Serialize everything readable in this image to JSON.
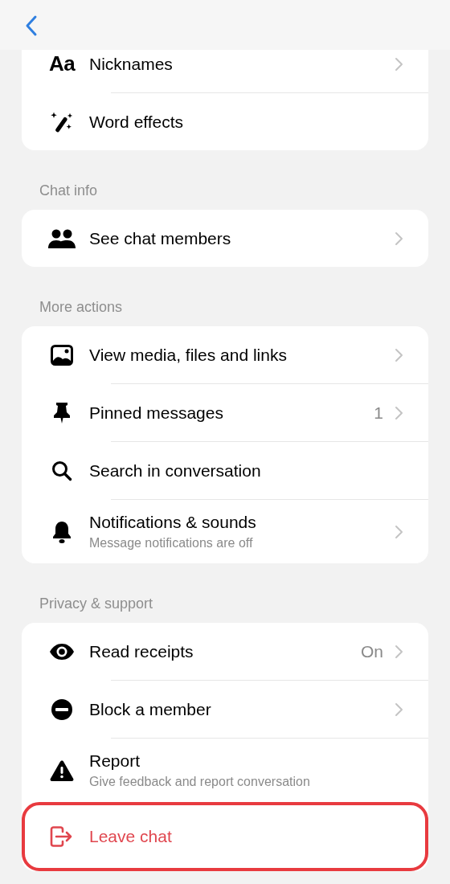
{
  "sections": [
    {
      "items": [
        {
          "icon_text": "Aa",
          "title": "Nicknames",
          "chevron": true,
          "kind": "normal"
        },
        {
          "title": "Word effects",
          "chevron": false,
          "kind": "normal"
        }
      ]
    },
    {
      "label": "Chat info",
      "items": [
        {
          "title": "See chat members",
          "chevron": true,
          "kind": "normal"
        }
      ]
    },
    {
      "label": "More actions",
      "items": [
        {
          "title": "View media, files and links",
          "chevron": true,
          "kind": "normal"
        },
        {
          "title": "Pinned messages",
          "value": "1",
          "chevron": true,
          "kind": "normal"
        },
        {
          "title": "Search in conversation",
          "chevron": false,
          "kind": "normal"
        },
        {
          "title": "Notifications & sounds",
          "subtitle": "Message notifications are off",
          "chevron": true,
          "kind": "normal"
        }
      ]
    },
    {
      "label": "Privacy & support",
      "items": [
        {
          "title": "Read receipts",
          "value": "On",
          "chevron": true,
          "kind": "normal"
        },
        {
          "title": "Block a member",
          "chevron": true,
          "kind": "normal"
        },
        {
          "title": "Report",
          "subtitle": "Give feedback and report conversation",
          "chevron": false,
          "kind": "normal"
        },
        {
          "title": "Leave chat",
          "chevron": false,
          "kind": "destructive",
          "highlighted": true
        }
      ]
    }
  ]
}
